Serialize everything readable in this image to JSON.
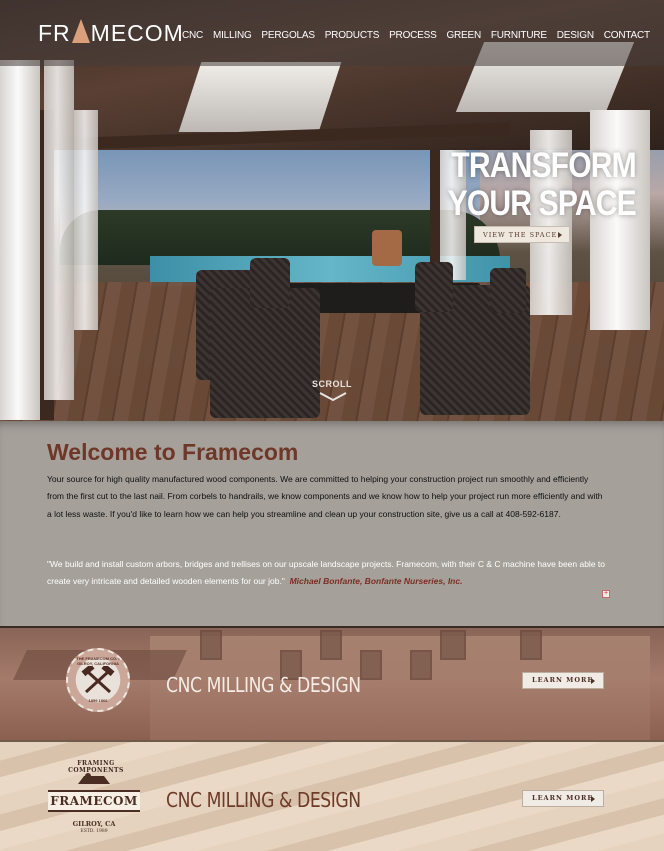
{
  "header": {
    "logo_text": "FR▲MECOM",
    "nav": [
      "CNC",
      "MILLING",
      "PERGOLAS",
      "PRODUCTS",
      "PROCESS",
      "GREEN",
      "FURNITURE",
      "DESIGN",
      "CONTACT"
    ]
  },
  "hero": {
    "headline_line1": "TRANSFORM",
    "headline_line2": "YOUR SPACE",
    "cta_label": "VIEW THE SPACE",
    "scroll_label": "SCROLL"
  },
  "welcome": {
    "title": "Welcome to Framecom",
    "body": "Your source for high quality manufactured wood components. We are committed to helping your construction project run smoothly and efficiently from the first cut to the last nail. From corbels to handrails, we know components and we know how to help your project run more efficiently and with a lot less waste. If you'd like to learn how we can help you streamline and clean up your construction site, give us a call at 408-592-6187.",
    "quote": "\"We build and install custom arbors, bridges and trellises on our upscale landscape projects. Framecom, with their C & C machine have been able to create very intricate and detailed wooden elements for our job.\"",
    "quote_author": "Michael Bonfante, Bonfante Nurseries, Inc."
  },
  "banners": [
    {
      "title": "CNC MILLING & DESIGN",
      "button": "LEARN MORE",
      "badge_text": "THE FRAMECOM CO. • GILROY, CALIFORNIA",
      "badge_years": "1859 1866"
    },
    {
      "title": "CNC MILLING & DESIGN",
      "button": "LEARN MORE",
      "badge_arc": "FRAMING COMPONENTS",
      "badge_name": "FRAMECOM",
      "badge_location": "GILROY, CA",
      "badge_est": "ESTD. 1989"
    }
  ],
  "colors": {
    "welcome_title": "#6e3727",
    "welcome_bg": "#a6a09b",
    "quote_author": "#7a2e22",
    "banner2_title": "#6e3b29"
  }
}
